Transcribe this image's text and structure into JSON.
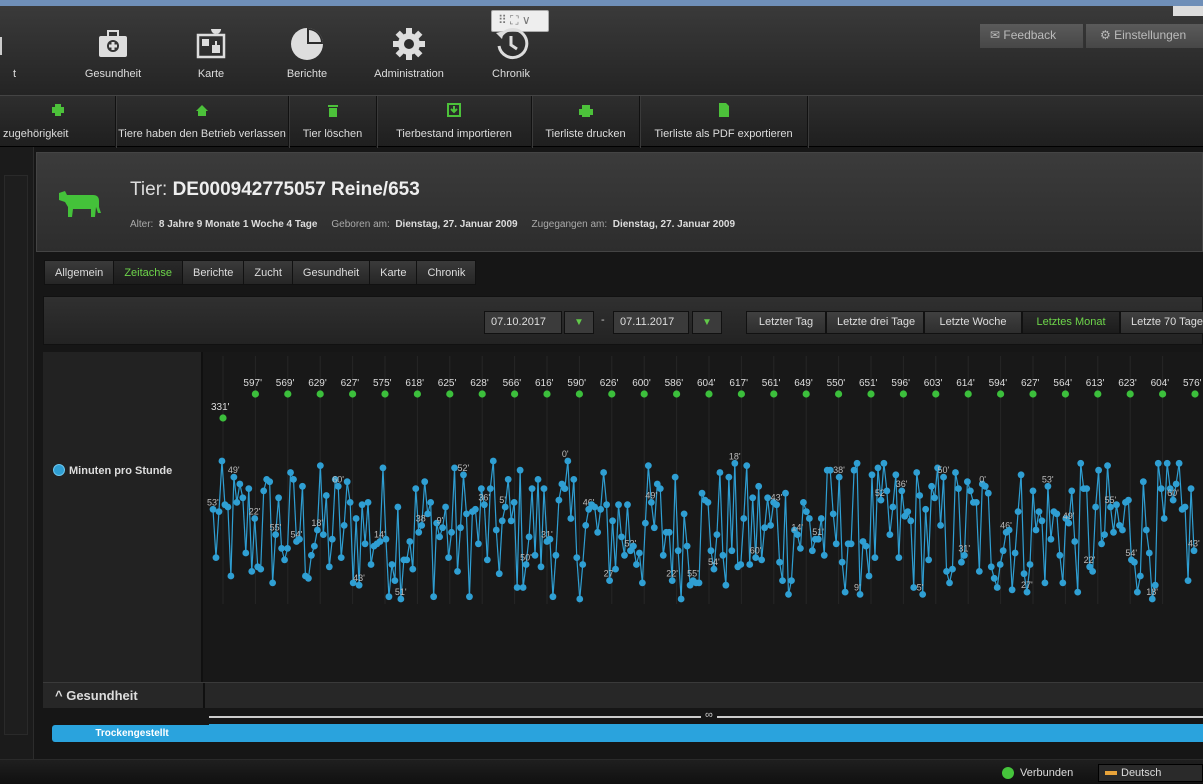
{
  "window": {
    "grip_label": "⠿ ⛶ ∨"
  },
  "topnav": {
    "items": [
      {
        "label": "Gesundheit",
        "icon": "medical-kit-icon"
      },
      {
        "label": "Karte",
        "icon": "map-icon"
      },
      {
        "label": "Berichte",
        "icon": "pie-chart-icon"
      },
      {
        "label": "Administration",
        "icon": "gear-icon"
      },
      {
        "label": "Chronik",
        "icon": "history-clock-icon"
      }
    ],
    "partial_label": "t",
    "feedback": "Feedback",
    "settings": "Einstellungen"
  },
  "toolbar": {
    "items": [
      {
        "label": "zugehörigkeit"
      },
      {
        "label": "Tiere haben den Betrieb verlassen"
      },
      {
        "label": "Tier löschen"
      },
      {
        "label": "Tierbestand importieren"
      },
      {
        "label": "Tierliste drucken"
      },
      {
        "label": "Tierliste als PDF exportieren"
      }
    ]
  },
  "animal": {
    "title_prefix": "Tier:",
    "title_id": "DE000942775057 Reine/653",
    "age_label": "Alter:",
    "age_value": "8 Jahre 9 Monate 1 Woche 4 Tage",
    "born_label": "Geboren am:",
    "born_value": "Dienstag, 27. Januar 2009",
    "added_label": "Zugegangen am:",
    "added_value": "Dienstag, 27. Januar 2009"
  },
  "tabs": [
    "Allgemein",
    "Zeitachse",
    "Berichte",
    "Zucht",
    "Gesundheit",
    "Karte",
    "Chronik"
  ],
  "active_tab": "Zeitachse",
  "filter": {
    "date_from": "07.10.2017",
    "dash": "-",
    "date_to": "07.11.2017",
    "ranges": [
      "Letzter Tag",
      "Letzte drei Tage",
      "Letzte Woche",
      "Letztes Monat",
      "Letzte 70 Tage"
    ],
    "active_range": "Letztes Monat"
  },
  "chart_data": {
    "type": "scatter",
    "series": [
      {
        "name": "Minuten pro Stunde",
        "color": "#2f9fd3"
      }
    ],
    "daily_totals": {
      "color": "#3cbf3c",
      "labels": [
        "331'",
        "597'",
        "569'",
        "629'",
        "627'",
        "575'",
        "618'",
        "625'",
        "628'",
        "566'",
        "616'",
        "590'",
        "626'",
        "600'",
        "586'",
        "604'",
        "617'",
        "561'",
        "649'",
        "550'",
        "651'",
        "596'",
        "603'",
        "614'",
        "594'",
        "627'",
        "564'",
        "613'",
        "623'",
        "604'",
        "576'"
      ]
    },
    "sample_hourly_labels": [
      "53'",
      "55'",
      "60'",
      "51'",
      "52'",
      "50'",
      "46'",
      "49'",
      "54'",
      "43'",
      "38'",
      "36'",
      "31'",
      "27'",
      "22'",
      "18'",
      "14'",
      "9'",
      "5'",
      "0'"
    ]
  },
  "sections": {
    "health_title": "Gesundheit",
    "health_item": "Trockengestellt",
    "infinity": "∞"
  },
  "status": {
    "connection": "Verbunden",
    "language": "Deutsch"
  },
  "colors": {
    "accent_green": "#6dd54a",
    "accent_blue": "#2aa3dd"
  }
}
